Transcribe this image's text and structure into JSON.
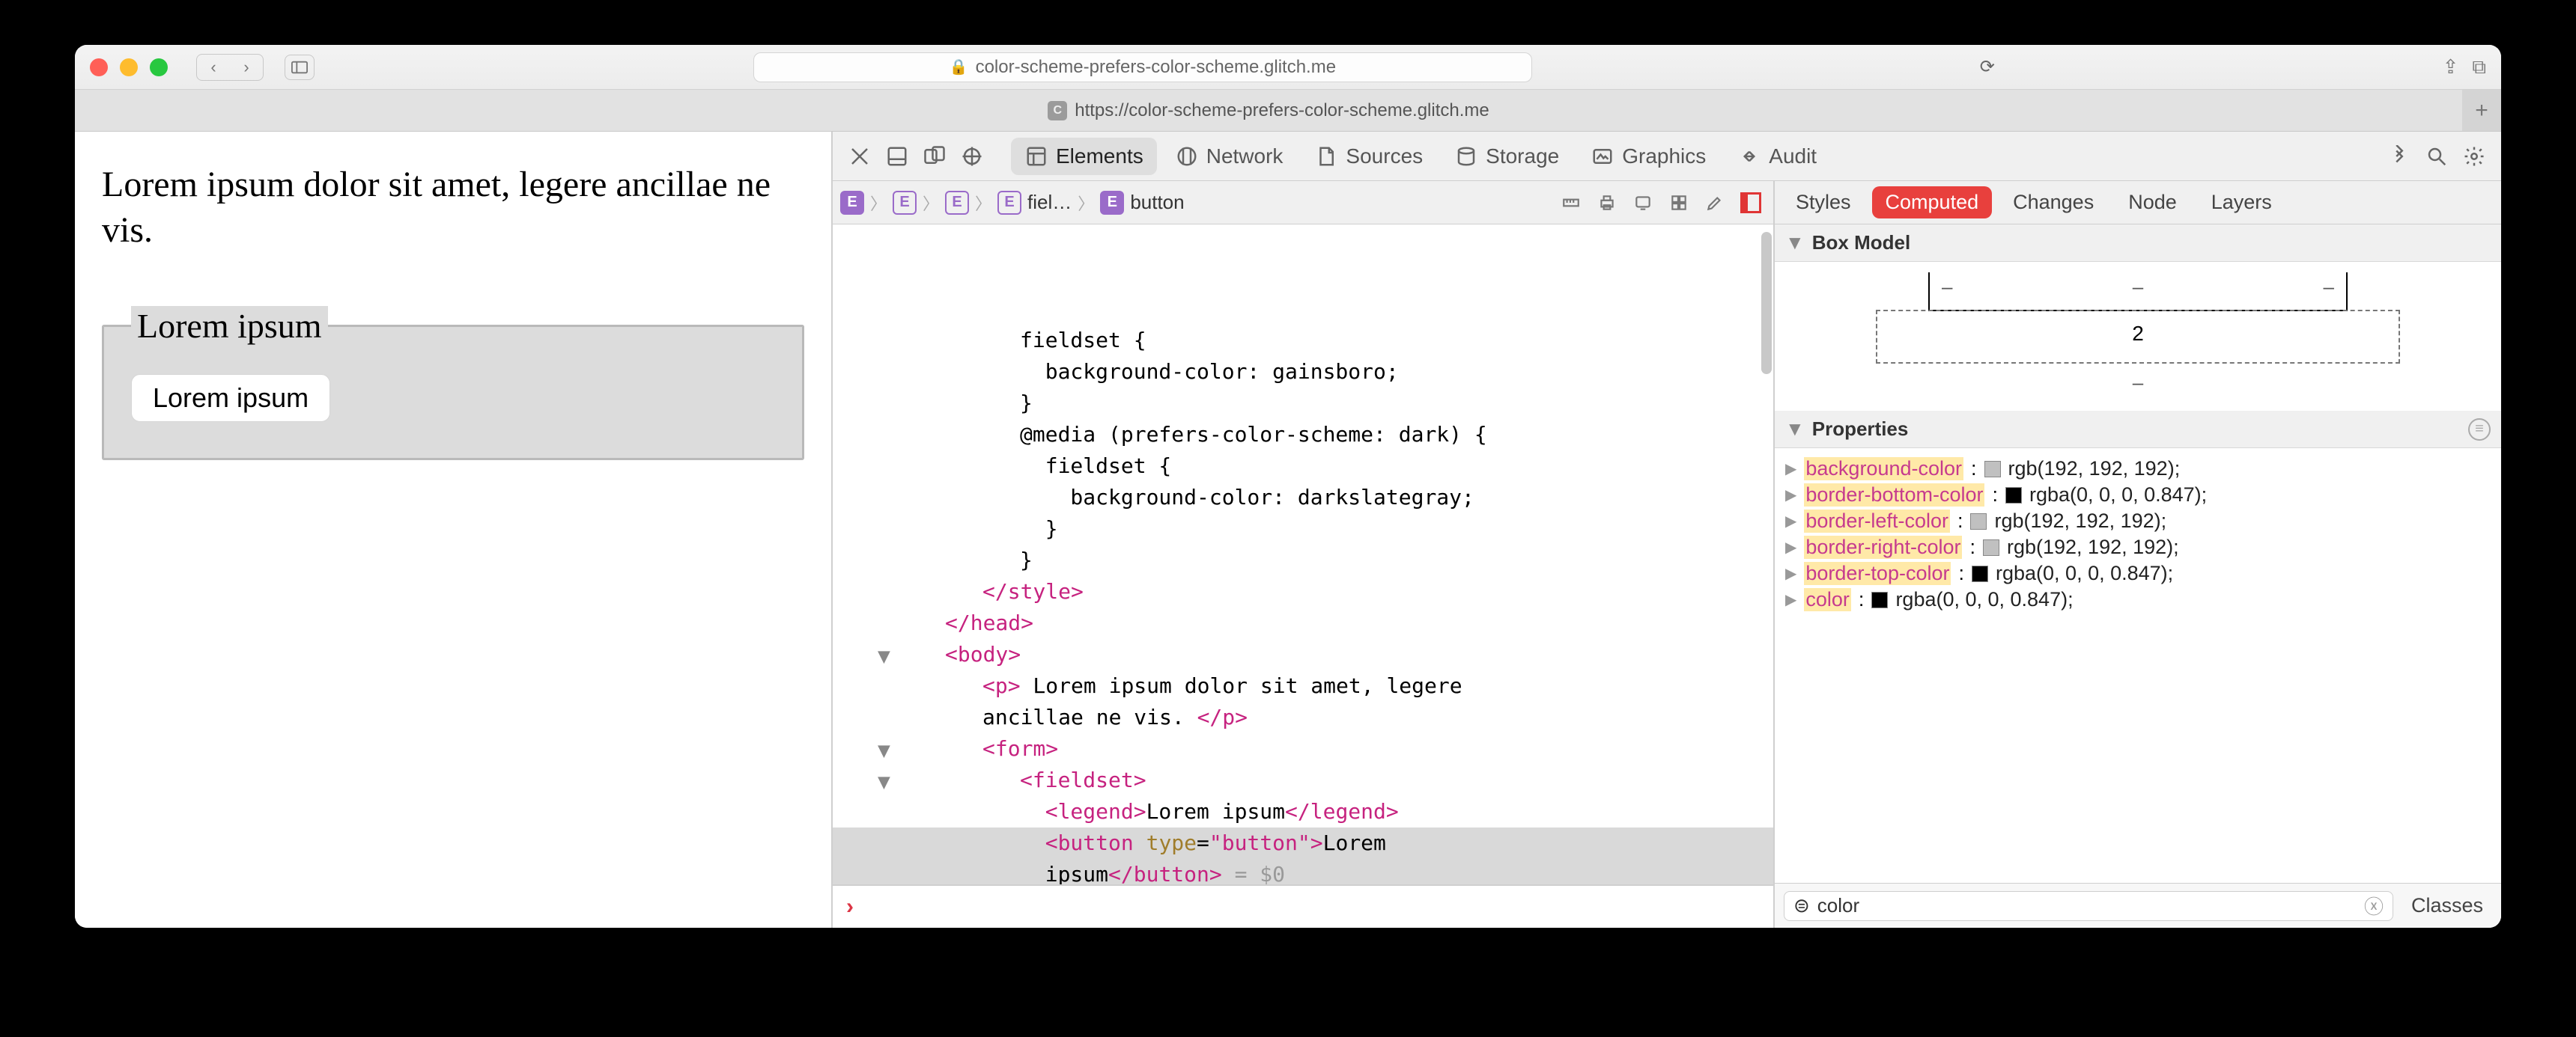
{
  "browser": {
    "url_host": "color-scheme-prefers-color-scheme.glitch.me",
    "tab_url": "https://color-scheme-prefers-color-scheme.glitch.me",
    "tab_favicon_letter": "C"
  },
  "page": {
    "paragraph": "Lorem ipsum dolor sit amet, legere ancillae ne vis.",
    "legend": "Lorem ipsum",
    "button_label": "Lorem ipsum"
  },
  "devtools": {
    "tabs": [
      "Elements",
      "Network",
      "Sources",
      "Storage",
      "Graphics",
      "Audit"
    ],
    "active_tab": "Elements",
    "breadcrumbs": [
      {
        "label": ""
      },
      {
        "label": ""
      },
      {
        "label": ""
      },
      {
        "label": "fiel…"
      },
      {
        "label": "button"
      }
    ],
    "dom_lines": [
      {
        "indent": 3,
        "html": "fieldset {"
      },
      {
        "indent": 3,
        "html": "  background-color: gainsboro;"
      },
      {
        "indent": 3,
        "html": "}"
      },
      {
        "indent": 3,
        "html": "@media (prefers-color-scheme: dark) {"
      },
      {
        "indent": 3,
        "html": "  fieldset {"
      },
      {
        "indent": 3,
        "html": "    background-color: darkslategray;"
      },
      {
        "indent": 3,
        "html": "  }"
      },
      {
        "indent": 3,
        "html": "}"
      },
      {
        "indent": 2,
        "html": "</style>",
        "tag": true
      },
      {
        "indent": 1,
        "html": "</head>",
        "tag": true
      },
      {
        "indent": 1,
        "html": "<body>",
        "tag": true,
        "disc": true
      },
      {
        "indent": 2,
        "html_rich": "<span class='tag'>&lt;p&gt;</span> Lorem ipsum dolor sit amet, legere"
      },
      {
        "indent": 2,
        "html_rich": "ancillae ne vis. <span class='tag'>&lt;/p&gt;</span>"
      },
      {
        "indent": 2,
        "html": "<form>",
        "tag": true,
        "disc": true
      },
      {
        "indent": 3,
        "html": "<fieldset>",
        "tag": true,
        "disc": true
      },
      {
        "indent": 3,
        "html_rich": "  <span class='tag'>&lt;legend&gt;</span>Lorem ipsum<span class='tag'>&lt;/legend&gt;</span>"
      },
      {
        "indent": 3,
        "sel": true,
        "html_rich": "  <span class='tag'>&lt;button</span> <span class='attrn'>type</span>=<span class='attrv'>\"button\"</span><span class='tag'>&gt;</span>Lorem"
      },
      {
        "indent": 3,
        "sel": true,
        "html_rich": "  ipsum<span class='tag'>&lt;/button&gt;</span> <span style='color:#999'>= $0</span>"
      }
    ],
    "side_tabs": [
      "Styles",
      "Computed",
      "Changes",
      "Node",
      "Layers"
    ],
    "side_active": "Computed",
    "boxmodel": {
      "header": "Box Model",
      "padding_bottom": "2"
    },
    "properties_header": "Properties",
    "properties": [
      {
        "name": "background-color",
        "swatch": "#c0c0c0",
        "val": "rgb(192, 192, 192)"
      },
      {
        "name": "border-bottom-color",
        "swatch": "#000000",
        "val": "rgba(0, 0, 0, 0.847)"
      },
      {
        "name": "border-left-color",
        "swatch": "#c0c0c0",
        "val": "rgb(192, 192, 192)"
      },
      {
        "name": "border-right-color",
        "swatch": "#c0c0c0",
        "val": "rgb(192, 192, 192)"
      },
      {
        "name": "border-top-color",
        "swatch": "#000000",
        "val": "rgba(0, 0, 0, 0.847)"
      },
      {
        "name": "color",
        "swatch": "#000000",
        "val": "rgba(0, 0, 0, 0.847)"
      }
    ],
    "filter_value": "color",
    "classes_label": "Classes"
  }
}
